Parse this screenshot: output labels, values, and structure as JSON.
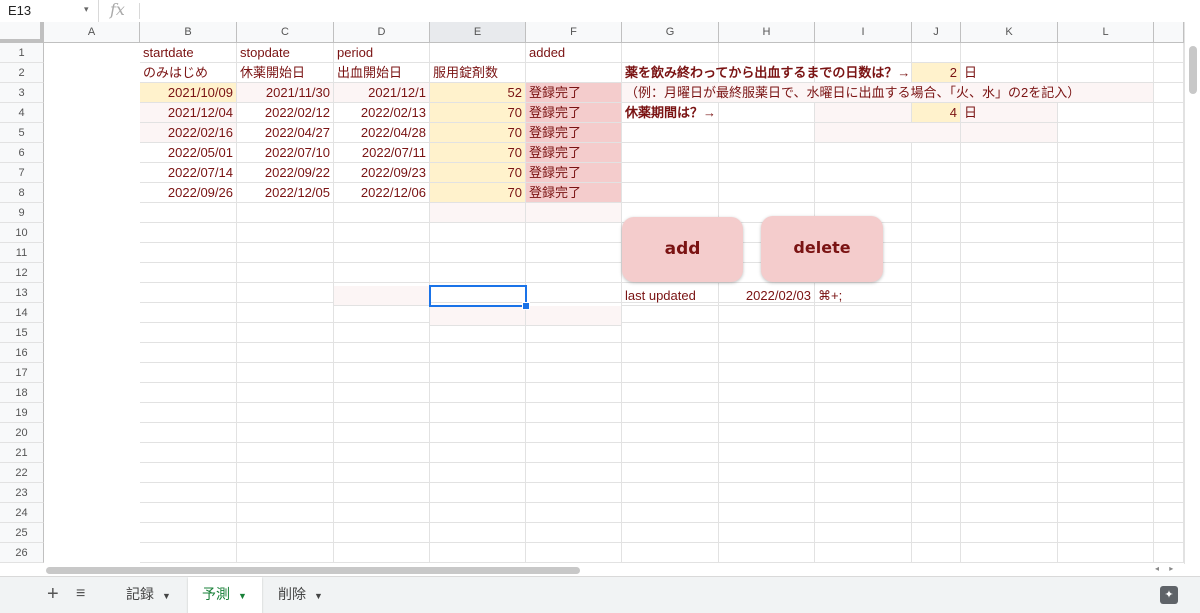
{
  "name_box": "E13",
  "fx_label": "fx",
  "columns": [
    "A",
    "B",
    "C",
    "D",
    "E",
    "F",
    "G",
    "H",
    "I",
    "J",
    "K",
    "L"
  ],
  "rows": [
    "1",
    "2",
    "3",
    "4",
    "5",
    "6",
    "7",
    "8",
    "9",
    "10",
    "11",
    "12",
    "13",
    "14",
    "15",
    "16",
    "17",
    "18",
    "19",
    "20",
    "21",
    "22",
    "23",
    "24",
    "25",
    "26"
  ],
  "header_en": {
    "b": "startdate",
    "c": "stopdate",
    "d": "period",
    "f": "added"
  },
  "header_ja": {
    "b": "のみはじめ",
    "c": "休薬開始日",
    "d": "出血開始日",
    "e": "服用錠剤数"
  },
  "data_rows": [
    {
      "b": "2021/10/09",
      "c": "2021/11/30",
      "d": "2021/12/1",
      "e": "52",
      "f": "登録完了"
    },
    {
      "b": "2021/12/04",
      "c": "2022/02/12",
      "d": "2022/02/13",
      "e": "70",
      "f": "登録完了"
    },
    {
      "b": "2022/02/16",
      "c": "2022/04/27",
      "d": "2022/04/28",
      "e": "70",
      "f": "登録完了"
    },
    {
      "b": "2022/05/01",
      "c": "2022/07/10",
      "d": "2022/07/11",
      "e": "70",
      "f": "登録完了"
    },
    {
      "b": "2022/07/14",
      "c": "2022/09/22",
      "d": "2022/09/23",
      "e": "70",
      "f": "登録完了"
    },
    {
      "b": "2022/09/26",
      "c": "2022/12/05",
      "d": "2022/12/06",
      "e": "70",
      "f": "登録完了"
    }
  ],
  "question1": "薬を飲み終わってから出血するまでの日数は？→",
  "answer1": "2",
  "unit1": "日",
  "example": "（例：月曜日が最終服薬日で、水曜日に出血する場合、「火、水」の2を記入）",
  "question2": "休薬期間は？→",
  "answer2": "4",
  "unit2": "日",
  "buttons": {
    "add": "add",
    "delete": "delete"
  },
  "last_updated_label": "last updated",
  "last_updated_date": "2022/02/03",
  "last_updated_extra": "⌘+;",
  "sheet_tabs": [
    {
      "label": "記録",
      "active": false
    },
    {
      "label": "予測",
      "active": true
    },
    {
      "label": "削除",
      "active": false
    }
  ],
  "colors": {
    "yellow": "#fff2cc",
    "pink": "#f4cccc",
    "text": "#7a1313",
    "selection": "#1a73e8",
    "active_tab": "#188038"
  }
}
